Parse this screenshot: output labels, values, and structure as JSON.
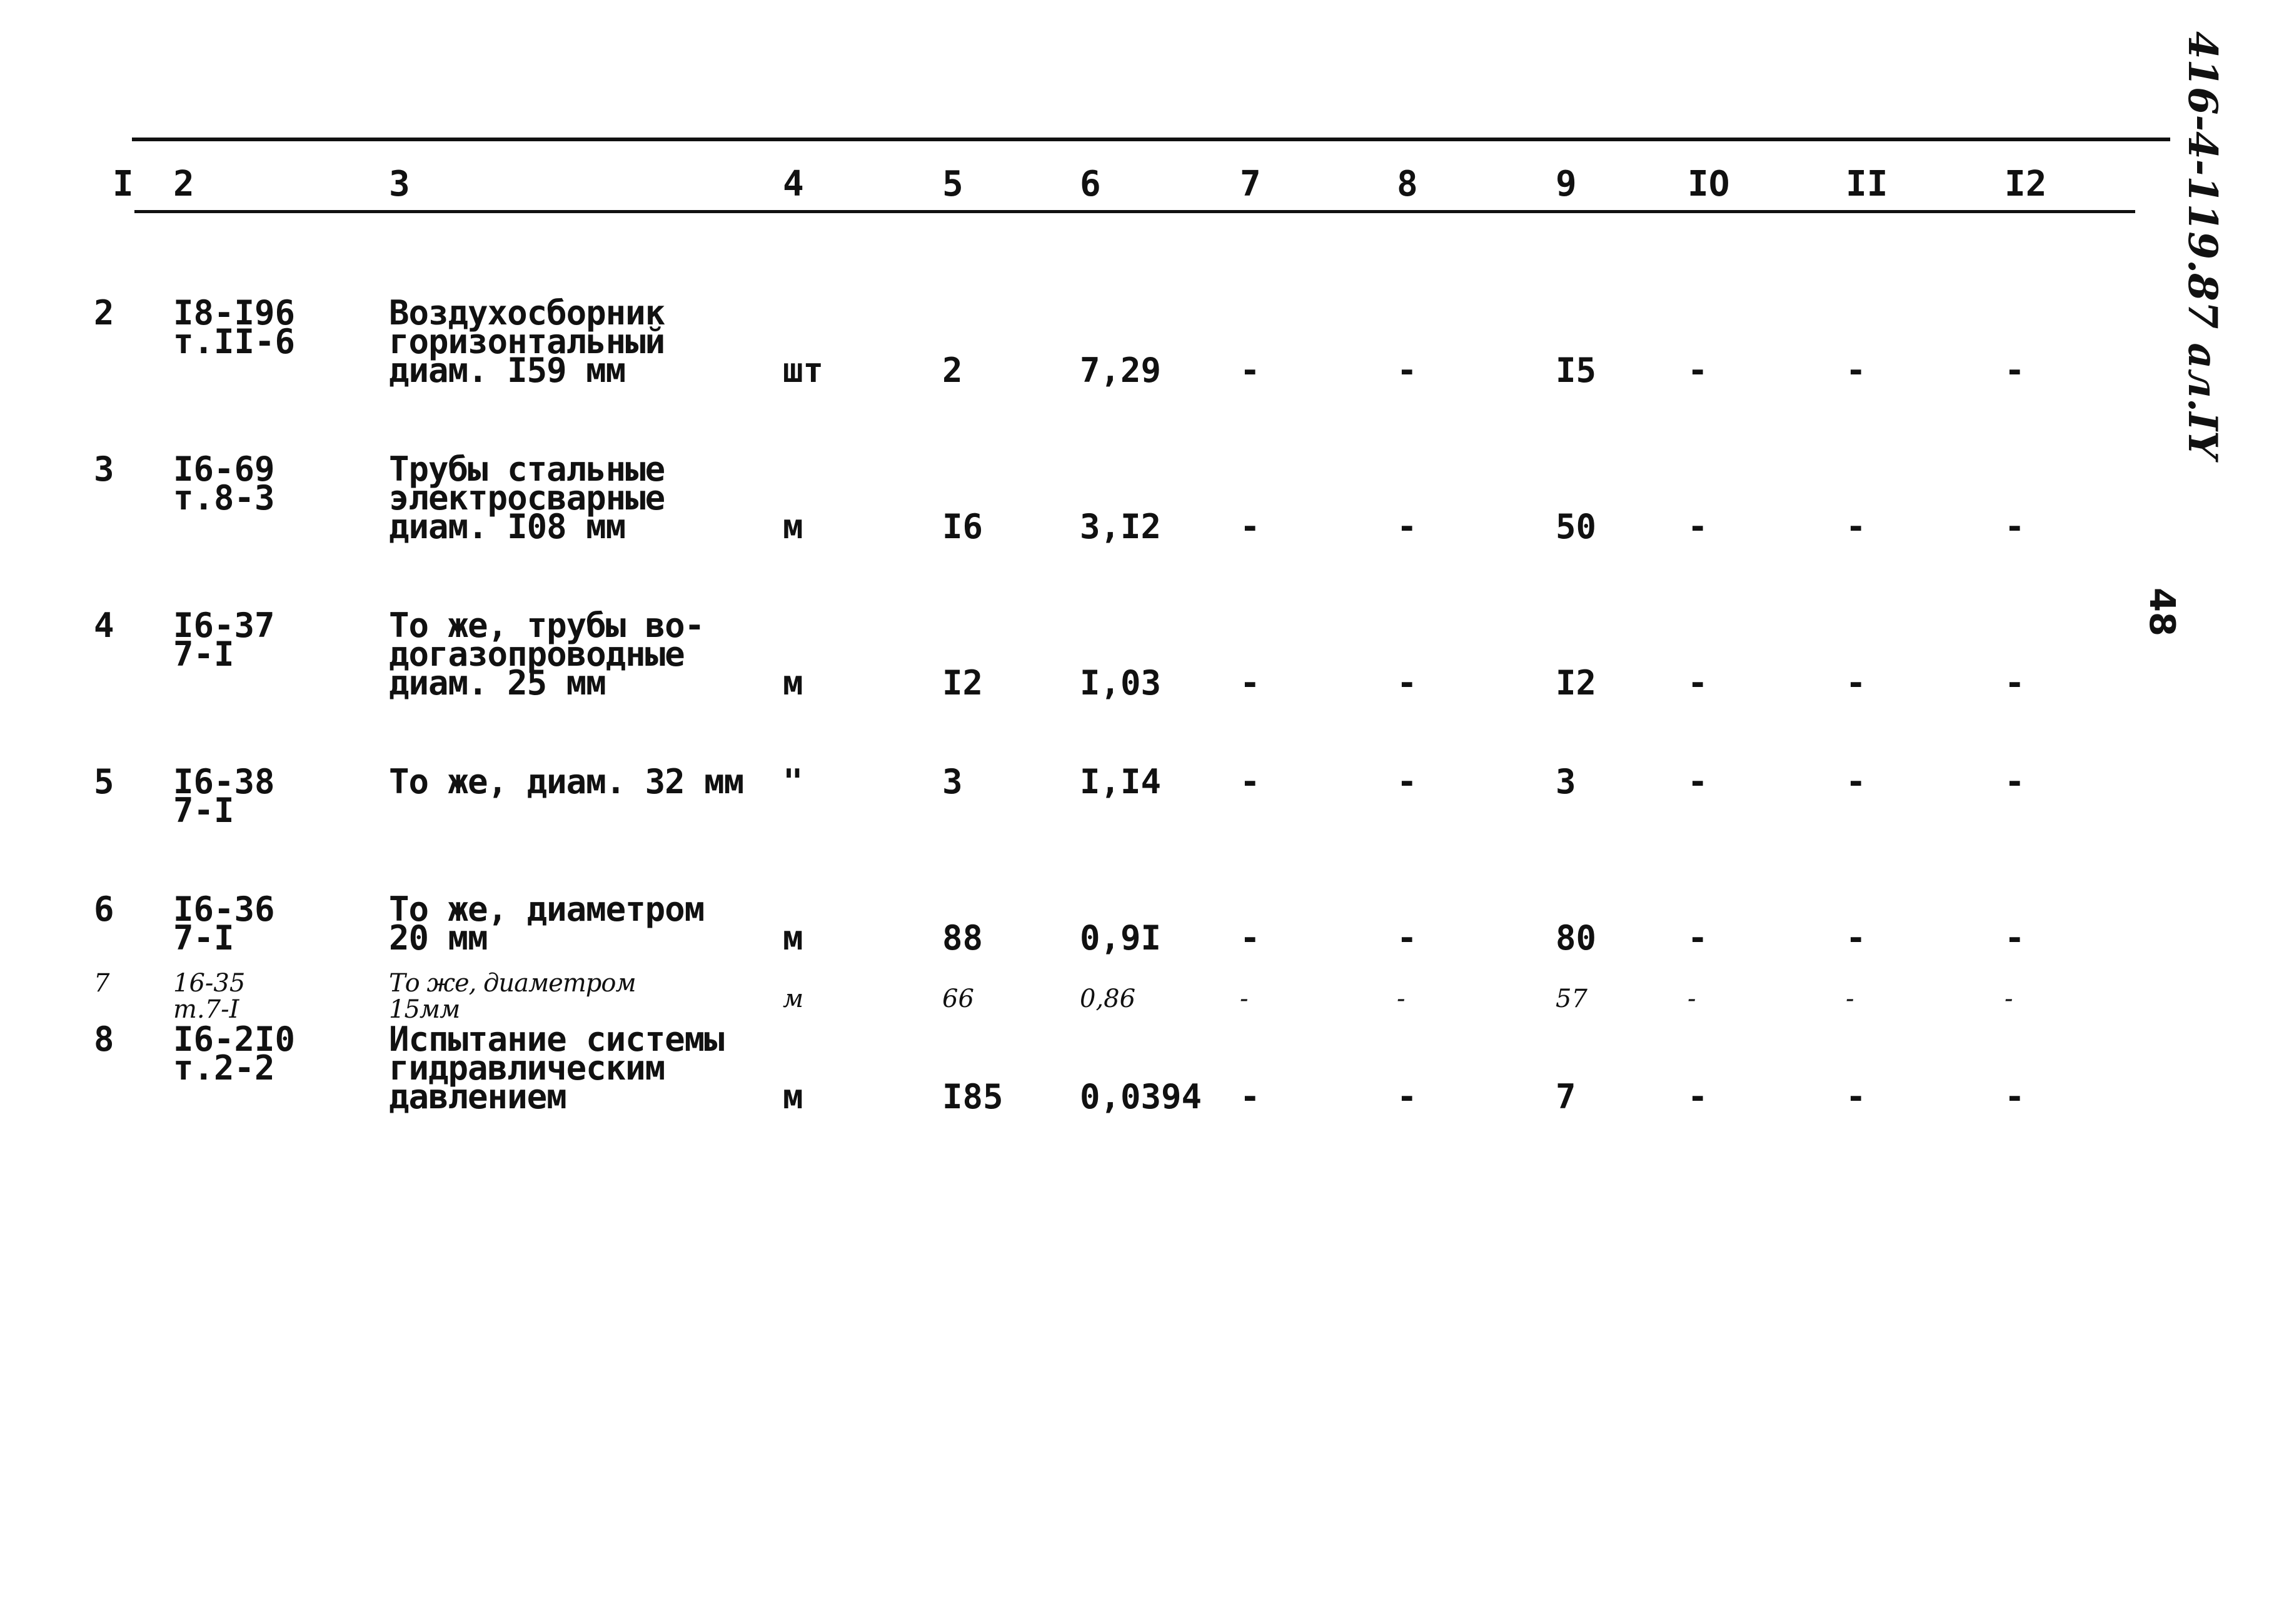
{
  "side_code": "416-4-119.87 ал.IY",
  "page_number": "48",
  "header": [
    "I",
    "2",
    "3",
    "4",
    "5",
    "6",
    "7",
    "8",
    "9",
    "IO",
    "II",
    "I2"
  ],
  "rows": [
    {
      "no": "2",
      "code": [
        "I8-I96",
        "т.II-6"
      ],
      "desc": [
        "Воздухосборник",
        "горизонтальный",
        "диам. I59 мм"
      ],
      "unit": "шт",
      "c5": "2",
      "c6": "7,29",
      "c7": "-",
      "c8": "-",
      "c9": "I5",
      "c10": "-",
      "c11": "-",
      "c12": "-"
    },
    {
      "no": "3",
      "code": [
        "I6-69",
        "т.8-3"
      ],
      "desc": [
        "Трубы стальные",
        "электросварные",
        "диам. I08 мм"
      ],
      "unit": "м",
      "c5": "I6",
      "c6": "3,I2",
      "c7": "-",
      "c8": "-",
      "c9": "50",
      "c10": "-",
      "c11": "-",
      "c12": "-"
    },
    {
      "no": "4",
      "code": [
        "I6-37",
        "7-I"
      ],
      "desc": [
        "То же, трубы во-",
        "догазопроводные",
        "диам. 25 мм"
      ],
      "unit": "м",
      "c5": "I2",
      "c6": "I,03",
      "c7": "-",
      "c8": "-",
      "c9": "I2",
      "c10": "-",
      "c11": "-",
      "c12": "-"
    },
    {
      "no": "5",
      "code": [
        "I6-38",
        "7-I"
      ],
      "desc": [
        "То же, диам. 32 мм"
      ],
      "unit": "\"",
      "c5": "3",
      "c6": "I,I4",
      "c7": "-",
      "c8": "-",
      "c9": "3",
      "c10": "-",
      "c11": "-",
      "c12": "-"
    },
    {
      "no": "6",
      "code": [
        "I6-36",
        "7-I"
      ],
      "desc": [
        "То же, диаметром",
        "20 мм"
      ],
      "unit": "м",
      "c5": "88",
      "c6": "0,9I",
      "c7": "-",
      "c8": "-",
      "c9": "80",
      "c10": "-",
      "c11": "-",
      "c12": "-"
    },
    {
      "no": "7",
      "code": [
        "16-35",
        "т.7-I"
      ],
      "desc": [
        "То же, диаметром",
        "15мм"
      ],
      "unit": "м",
      "c5": "66",
      "c6": "0,86",
      "c7": "-",
      "c8": "-",
      "c9": "57",
      "c10": "-",
      "c11": "-",
      "c12": "-",
      "handwritten": true
    },
    {
      "no": "8",
      "code": [
        "I6-2I0",
        "т.2-2"
      ],
      "desc": [
        "Испытание системы",
        "гидравлическим",
        "давлением"
      ],
      "unit": "м",
      "c5": "I85",
      "c6": "0,0394",
      "c7": "-",
      "c8": "-",
      "c9": "7",
      "c10": "-",
      "c11": "-",
      "c12": "-"
    }
  ]
}
